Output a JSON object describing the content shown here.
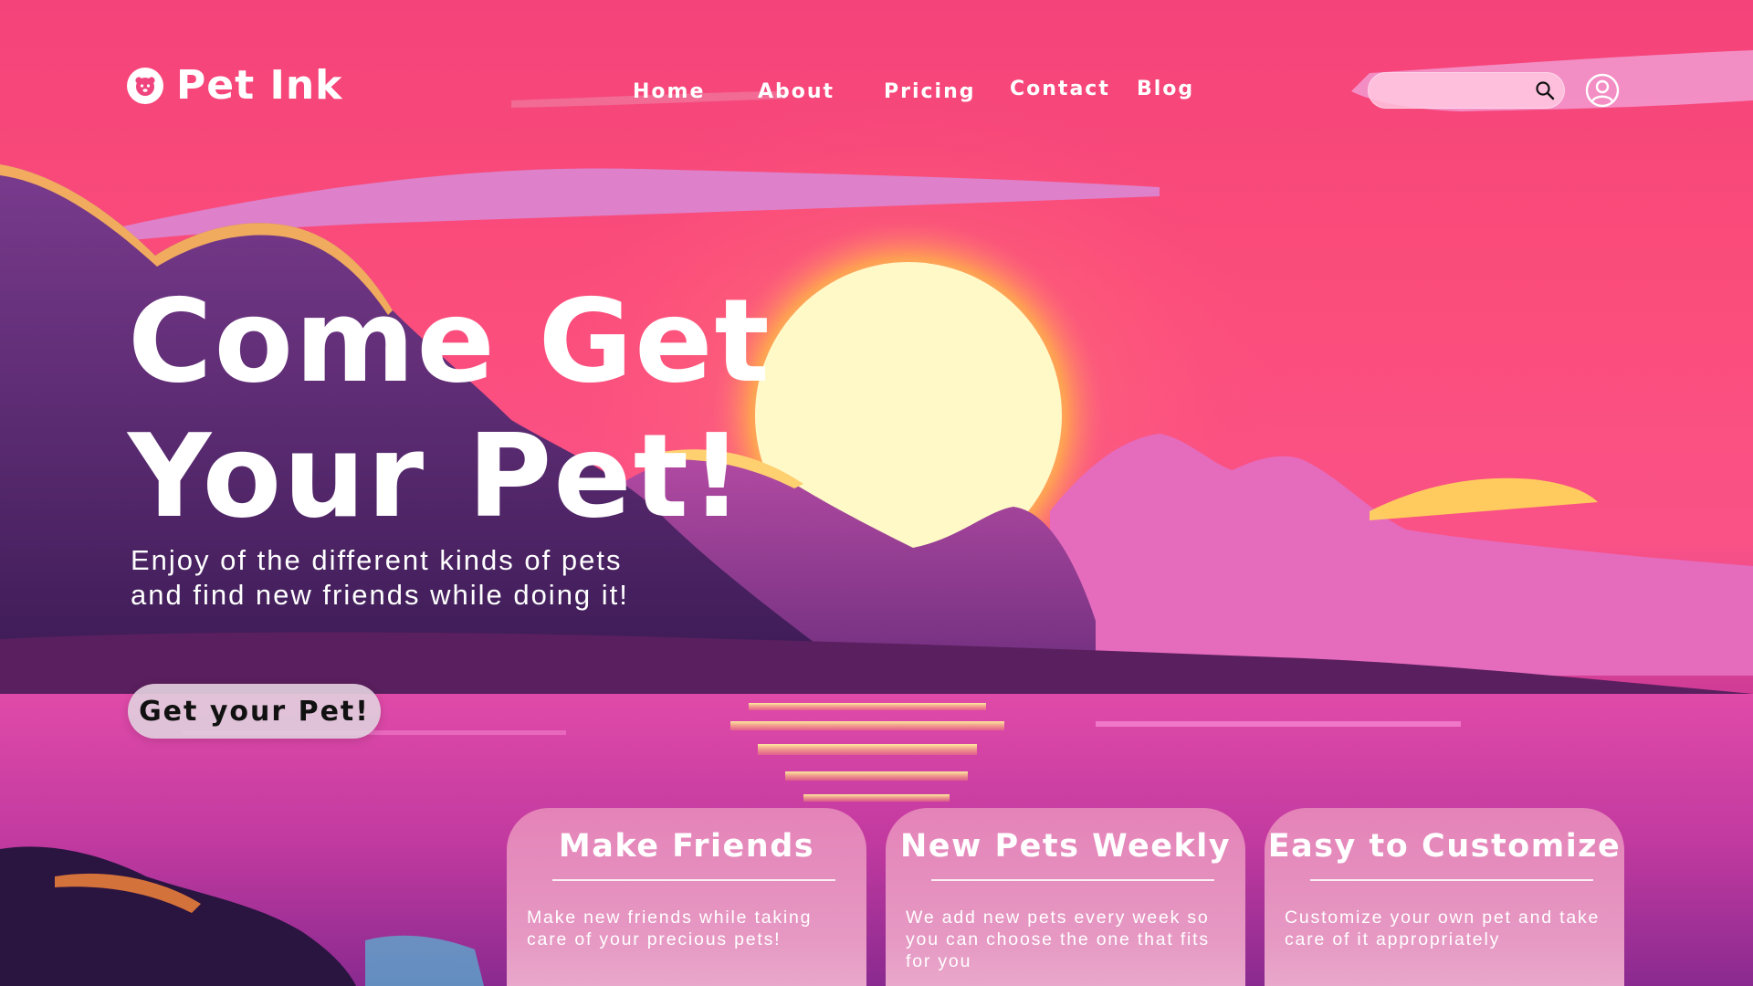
{
  "brand": {
    "name": "Pet Ink",
    "icon": "paw-face-icon"
  },
  "nav": {
    "items": [
      {
        "label": "Home"
      },
      {
        "label": "About"
      },
      {
        "label": "Pricing"
      },
      {
        "label": "Contact"
      },
      {
        "label": "Blog"
      }
    ]
  },
  "search": {
    "placeholder": "",
    "value": "",
    "icon": "search-icon"
  },
  "user": {
    "icon": "user-icon"
  },
  "hero": {
    "title_line1": "Come Get",
    "title_line2": "Your Pet!",
    "subtitle_line1": "Enjoy of the different kinds of pets",
    "subtitle_line2": "and find new friends while doing it!",
    "cta_label": "Get your Pet!"
  },
  "cards": [
    {
      "title": "Make Friends",
      "text": "Make new friends while taking care of your precious pets!"
    },
    {
      "title": "New Pets Weekly",
      "text": "We add new pets every week so you can choose the one that fits for you"
    },
    {
      "title": "Easy to Customize",
      "text": "Customize your own pet and take care of it appropriately"
    }
  ],
  "colors": {
    "sky": "#f4437a",
    "sun": "#fff6b0",
    "mountain": "#5a2a6e",
    "water": "#c2359b",
    "card": "#f0a0c8"
  }
}
